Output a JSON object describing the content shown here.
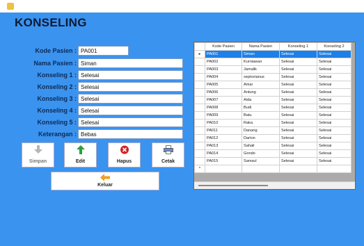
{
  "window": {
    "title_icon": "app-icon"
  },
  "heading": "KONSELING",
  "form": {
    "kode_label": "Kode Pasien :",
    "kode_value": "PA001",
    "nama_label": "Nama Pasien :",
    "nama_value": "Siman",
    "k1_label": "Konseling 1 :",
    "k1_value": "Selesai",
    "k2_label": "Konseling 2 :",
    "k2_value": "Selesai",
    "k3_label": "Konseling 3 :",
    "k3_value": "Selesai",
    "k4_label": "Konseling 4 :",
    "k4_value": "Selesai",
    "k5_label": "Konseling 5 :",
    "k5_value": "Selesai",
    "ket_label": "Keterangan :",
    "ket_value": "Bebas"
  },
  "buttons": {
    "simpan": "Simpan",
    "edit": "Edit",
    "hapus": "Hapus",
    "cetak": "Cetak",
    "keluar": "Keluar"
  },
  "grid": {
    "headers": [
      "Kode Pasien",
      "Nama Pasien",
      "Konseling 1",
      "Konseling 2"
    ],
    "selected_marker": "▸",
    "new_row_marker": "*",
    "rows": [
      [
        "PA001",
        "Siman",
        "Selesai",
        "Selesai"
      ],
      [
        "PA002",
        "Kurniawan",
        "Selesai",
        "Selesai"
      ],
      [
        "PA003",
        "Jamalik",
        "Selesai",
        "Selesai"
      ],
      [
        "PA004",
        "septovianus",
        "Selesai",
        "Selesai"
      ],
      [
        "PA005",
        "Amar",
        "Selesai",
        "Selesai"
      ],
      [
        "PA006",
        "Antung",
        "Selesai",
        "Selesai"
      ],
      [
        "PA007",
        "Aida",
        "Selesai",
        "Selesai"
      ],
      [
        "PA008",
        "Budi",
        "Selesai",
        "Selesai"
      ],
      [
        "PA009",
        "Batu",
        "Selesai",
        "Selesai"
      ],
      [
        "PA010",
        "Raka",
        "Selesai",
        "Selesai"
      ],
      [
        "PA011",
        "Danang",
        "Selesai",
        "Selesai"
      ],
      [
        "PA012",
        "Darton",
        "Selesai",
        "Selesai"
      ],
      [
        "PA013",
        "Sahali",
        "Selesai",
        "Selesai"
      ],
      [
        "PA014",
        "Gondo",
        "Selesai",
        "Selesai"
      ],
      [
        "PA015",
        "Samsul",
        "Selesai",
        "Selesai"
      ]
    ]
  },
  "colors": {
    "background": "#3a93ef",
    "selection": "#1d7fe8",
    "heading": "#0d1a33"
  }
}
